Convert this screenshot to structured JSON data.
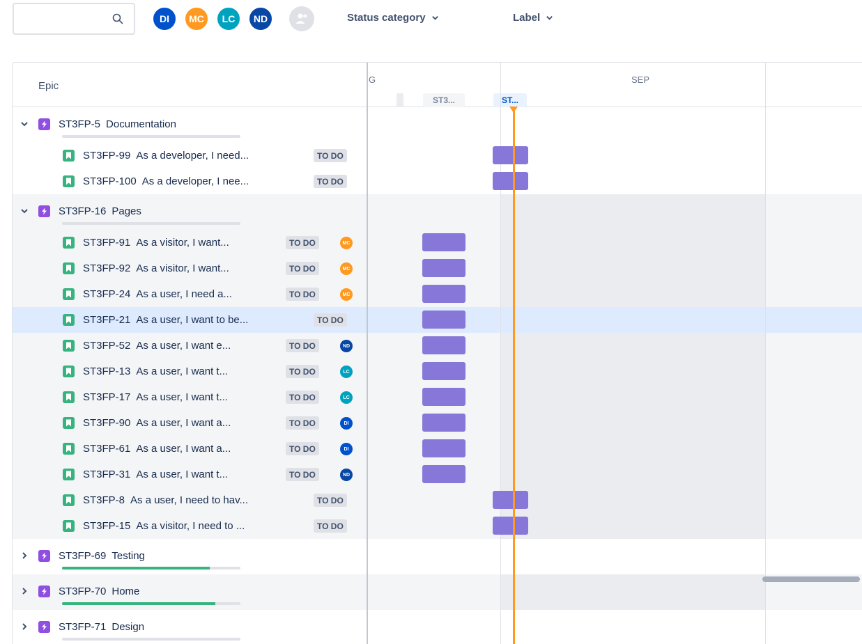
{
  "toolbar": {
    "search_placeholder": "",
    "avatars": [
      {
        "initials": "DI",
        "color": "#0052cc"
      },
      {
        "initials": "MC",
        "color": "#ff991f"
      },
      {
        "initials": "LC",
        "color": "#00a3bf"
      },
      {
        "initials": "ND",
        "color": "#0747a6"
      }
    ],
    "filters": [
      "Status category",
      "Label"
    ]
  },
  "timeline": {
    "epic_header": "Epic",
    "months": [
      "G",
      "SEP"
    ],
    "sprints": [
      {
        "label": "ST3...",
        "state": "past"
      },
      {
        "label": "ST...",
        "state": "current"
      }
    ]
  },
  "rows": [
    {
      "kind": "epic",
      "expanded": true,
      "key": "ST3FP-5",
      "title": "Documentation",
      "progress": 0,
      "group": false
    },
    {
      "kind": "story",
      "key": "ST3FP-99",
      "title": "As a developer, I need...",
      "status": "TO DO",
      "assignee": null,
      "bar": "late",
      "group": false
    },
    {
      "kind": "story",
      "key": "ST3FP-100",
      "title": "As a developer, I nee...",
      "status": "TO DO",
      "assignee": null,
      "bar": "late",
      "group": false
    },
    {
      "kind": "epic",
      "expanded": true,
      "key": "ST3FP-16",
      "title": "Pages",
      "progress": 0,
      "group": true
    },
    {
      "kind": "story",
      "key": "ST3FP-91",
      "title": "As a visitor, I want...",
      "status": "TO DO",
      "assignee": "MC",
      "bar": "early",
      "group": true
    },
    {
      "kind": "story",
      "key": "ST3FP-92",
      "title": "As a visitor, I want...",
      "status": "TO DO",
      "assignee": "MC",
      "bar": "early",
      "group": true
    },
    {
      "kind": "story",
      "key": "ST3FP-24",
      "title": "As a user, I need a...",
      "status": "TO DO",
      "assignee": "MC",
      "bar": "early",
      "group": true
    },
    {
      "kind": "story",
      "key": "ST3FP-21",
      "title": "As a user, I want to be...",
      "status": "TO DO",
      "assignee": null,
      "bar": "early",
      "group": true,
      "selected": true
    },
    {
      "kind": "story",
      "key": "ST3FP-52",
      "title": "As a user, I want e...",
      "status": "TO DO",
      "assignee": "ND",
      "bar": "early",
      "group": true
    },
    {
      "kind": "story",
      "key": "ST3FP-13",
      "title": "As a user, I want t...",
      "status": "TO DO",
      "assignee": "LC",
      "bar": "early",
      "group": true
    },
    {
      "kind": "story",
      "key": "ST3FP-17",
      "title": "As a user, I want t...",
      "status": "TO DO",
      "assignee": "LC",
      "bar": "early",
      "group": true
    },
    {
      "kind": "story",
      "key": "ST3FP-90",
      "title": "As a user, I want a...",
      "status": "TO DO",
      "assignee": "DI",
      "bar": "early",
      "group": true
    },
    {
      "kind": "story",
      "key": "ST3FP-61",
      "title": "As a user, I want a...",
      "status": "TO DO",
      "assignee": "DI",
      "bar": "early",
      "group": true
    },
    {
      "kind": "story",
      "key": "ST3FP-31",
      "title": "As a user, I want t...",
      "status": "TO DO",
      "assignee": "ND",
      "bar": "early",
      "group": true
    },
    {
      "kind": "story",
      "key": "ST3FP-8",
      "title": "As a user, I need to hav...",
      "status": "TO DO",
      "assignee": null,
      "bar": "late",
      "group": true
    },
    {
      "kind": "story",
      "key": "ST3FP-15",
      "title": "As a visitor, I need to ...",
      "status": "TO DO",
      "assignee": null,
      "bar": "late",
      "group": true
    },
    {
      "kind": "epic",
      "expanded": false,
      "key": "ST3FP-69",
      "title": "Testing",
      "progress": 0.83,
      "group": false
    },
    {
      "kind": "epic",
      "expanded": false,
      "key": "ST3FP-70",
      "title": "Home",
      "progress": 0.86,
      "group": true
    },
    {
      "kind": "epic",
      "expanded": false,
      "key": "ST3FP-71",
      "title": "Design",
      "progress": 0,
      "group": false
    }
  ],
  "colors": {
    "epic": "#904ee2",
    "story": "#36b37e",
    "bar": "#8777d9",
    "today": "#ff991f",
    "selected_row": "#deebff"
  }
}
